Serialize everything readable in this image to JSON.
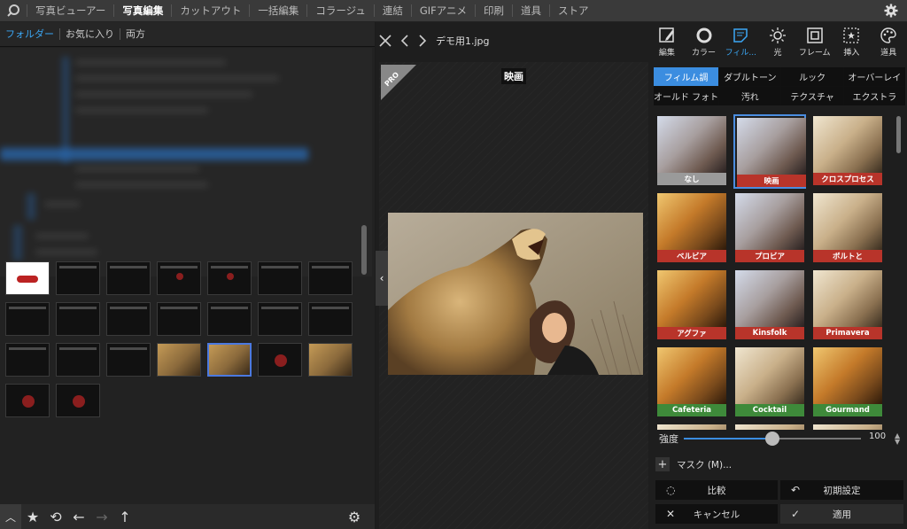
{
  "menu": [
    "写真ビューアー",
    "写真編集",
    "カットアウト",
    "一括編集",
    "コラージュ",
    "連結",
    "GIFアニメ",
    "印刷",
    "道具",
    "ストア"
  ],
  "menu_active_index": 1,
  "folder_tabs": [
    "フォルダー",
    "お気に入り",
    "両方"
  ],
  "file": {
    "name": "デモ用1.jpg"
  },
  "preview": {
    "filter_label": "映画",
    "pro_badge": "PRO"
  },
  "tools": [
    {
      "label": "編集",
      "icon": "edit-icon"
    },
    {
      "label": "カラー",
      "icon": "color-circle-icon"
    },
    {
      "label": "フィル...",
      "icon": "filter-icon",
      "active": true
    },
    {
      "label": "光",
      "icon": "sun-icon"
    },
    {
      "label": "フレーム",
      "icon": "frame-icon"
    },
    {
      "label": "挿入",
      "icon": "insert-icon"
    },
    {
      "label": "道具",
      "icon": "palette-icon"
    }
  ],
  "filter_tabs": [
    "フィルム調",
    "ダブルトーン",
    "ルック",
    "オーバーレイ",
    "オールド フォト",
    "汚れ",
    "テクスチャ",
    "エクストラ"
  ],
  "filter_tab_active": 0,
  "filters": [
    {
      "label": "なし",
      "tag": "gray",
      "tone": "cool"
    },
    {
      "label": "映画",
      "tag": "red",
      "tone": "cool",
      "selected": true
    },
    {
      "label": "クロスプロセス",
      "tag": "red",
      "tone": "pale"
    },
    {
      "label": "ベルビア",
      "tag": "red",
      "tone": "warm"
    },
    {
      "label": "プロビア",
      "tag": "red",
      "tone": "cool"
    },
    {
      "label": "ボルトと",
      "tag": "red",
      "tone": "pale"
    },
    {
      "label": "アグファ",
      "tag": "red",
      "tone": "warm"
    },
    {
      "label": "Kinsfolk",
      "tag": "red",
      "tone": "cool"
    },
    {
      "label": "Primavera",
      "tag": "red",
      "tone": "pale"
    },
    {
      "label": "Cafeteria",
      "tag": "green",
      "tone": "warm"
    },
    {
      "label": "Cocktail",
      "tag": "green",
      "tone": "pale"
    },
    {
      "label": "Gourmand",
      "tag": "green",
      "tone": "warm"
    }
  ],
  "strength": {
    "label": "強度",
    "value": "100",
    "fraction": 0.5
  },
  "mask": {
    "label": "マスク (M)..."
  },
  "buttons": {
    "compare": "比較",
    "reset": "初期設定",
    "cancel": "キャンセル",
    "apply": "適用"
  },
  "colors": {
    "accent": "#3b8de0",
    "tag_red": "#b8342a",
    "tag_green": "#3e8a3a",
    "tag_gray": "#9a9a9a"
  }
}
